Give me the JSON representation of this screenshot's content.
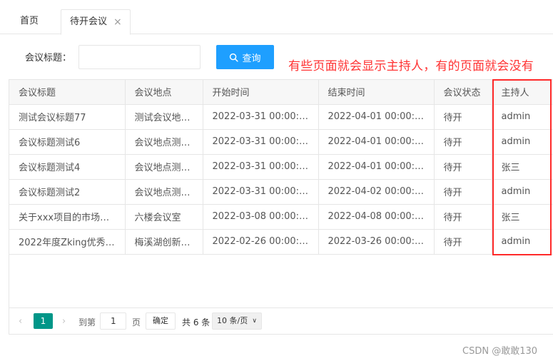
{
  "tabs": {
    "home_label": "首页",
    "active_label": "待开会议",
    "close_glyph": "×"
  },
  "search": {
    "label": "会议标题：",
    "input_value": "",
    "button_label": "查询"
  },
  "annotation": "有些页面就会显示主持人，有的页面就会没有",
  "table": {
    "columns": [
      "会议标题",
      "会议地点",
      "开始时间",
      "结束时间",
      "会议状态",
      "主持人"
    ],
    "rows": [
      [
        "测试会议标题77",
        "测试会议地…",
        "2022-03-31 00:00:00",
        "2022-04-01 00:00:00",
        "待开",
        "admin"
      ],
      [
        "会议标题测试6",
        "会议地点测…",
        "2022-03-31 00:00:00",
        "2022-04-01 00:00:00",
        "待开",
        "admin"
      ],
      [
        "会议标题测试4",
        "会议地点测…",
        "2022-03-31 00:00:00",
        "2022-04-01 00:00:00",
        "待开",
        "张三"
      ],
      [
        "会议标题测试2",
        "会议地点测…",
        "2022-03-31 00:00:00",
        "2022-04-02 00:00:00",
        "待开",
        "admin"
      ],
      [
        "关于xxx项目的市场主…",
        "六楼会议室",
        "2022-03-08 00:00:00",
        "2022-04-08 00:00:00",
        "待开",
        "张三"
      ],
      [
        "2022年度Zking优秀…",
        "梅溪湖创新…",
        "2022-02-26 00:00:00",
        "2022-03-26 00:00:00",
        "待开",
        "admin"
      ]
    ]
  },
  "pager": {
    "current_page": "1",
    "goto_prefix": "到第",
    "goto_value": "1",
    "goto_suffix": "页",
    "confirm_label": "确定",
    "total_text": "共 6 条",
    "page_size": "10 条/页"
  },
  "watermark": "CSDN @敢敢130",
  "colors": {
    "primary_button": "#1e9fff",
    "pager_active": "#009688",
    "annotation_red": "#ff3333"
  }
}
